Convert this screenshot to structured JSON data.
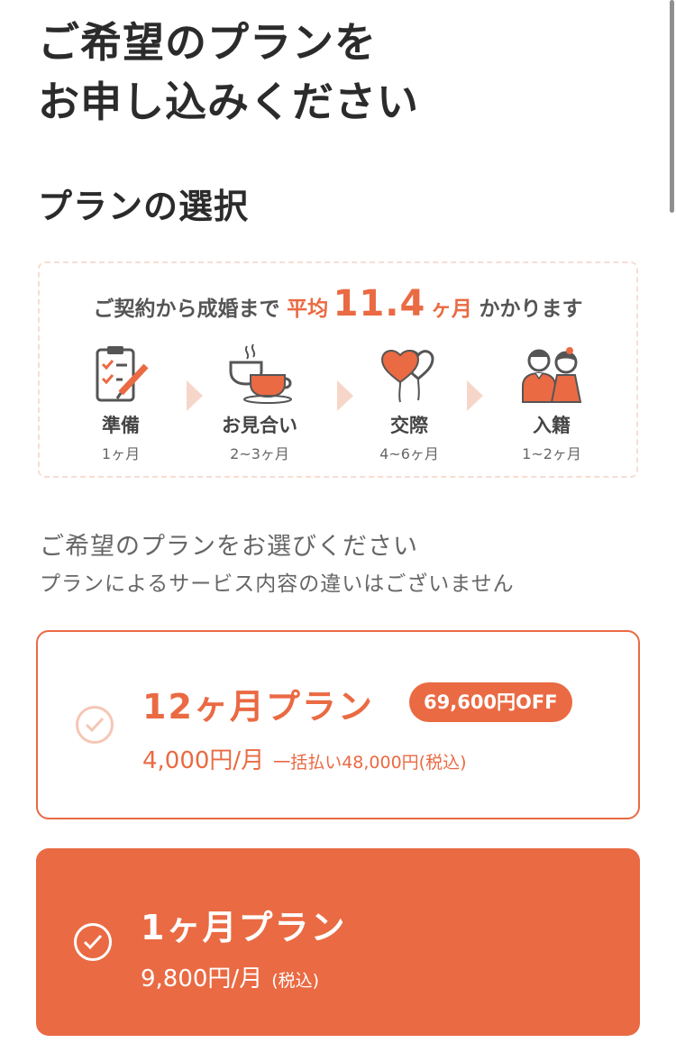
{
  "page": {
    "title_lines": [
      "ご希望のプランを",
      "お申し込みください"
    ],
    "section_title": "プランの選択"
  },
  "info": {
    "headline_prefix": "ご契約から成婚まで",
    "headline_avg": "平均",
    "headline_number": "11.4",
    "headline_unit": "ヶ月",
    "headline_suffix": "かかります",
    "steps": [
      {
        "label": "準備",
        "duration": "1ヶ月",
        "icon": "clipboard-pencil-icon"
      },
      {
        "label": "お見合い",
        "duration": "2~3ヶ月",
        "icon": "coffee-cups-icon"
      },
      {
        "label": "交際",
        "duration": "4~6ヶ月",
        "icon": "heart-balloons-icon"
      },
      {
        "label": "入籍",
        "duration": "1~2ヶ月",
        "icon": "wedding-couple-icon"
      }
    ]
  },
  "lead": {
    "line1": "ご希望のプランをお選びください",
    "line2": "プランによるサービス内容の違いはございません"
  },
  "plans": [
    {
      "name": "12ヶ月プラン",
      "badge": "69,600円OFF",
      "price": "4,000円/月",
      "note": "一括払い48,000円(税込)",
      "selected": false
    },
    {
      "name": "1ヶ月プラン",
      "price": "9,800円/月",
      "note": "(税込)",
      "selected": true
    }
  ],
  "colors": {
    "accent": "#ea6a43",
    "accent_light": "#f7d6ca",
    "text_dark": "#2b2b2b",
    "text_muted": "#666666"
  }
}
